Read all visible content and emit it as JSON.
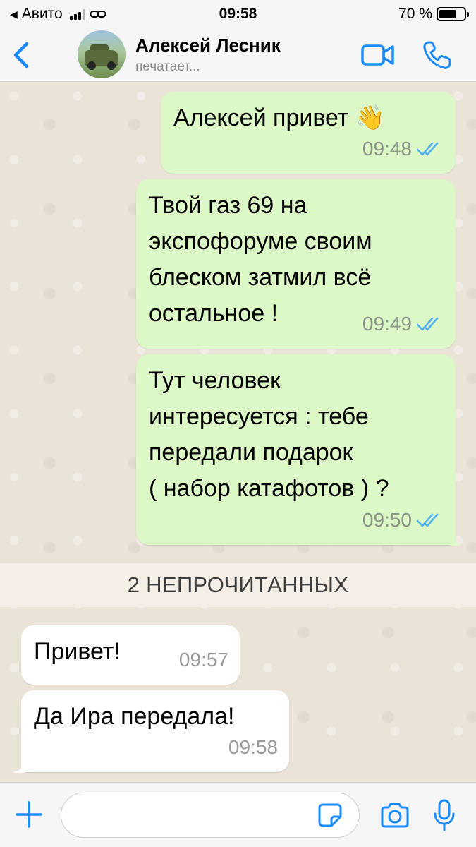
{
  "status_bar": {
    "back_app": "Авито",
    "time": "09:58",
    "battery_percent": "70 %",
    "battery_level": 0.7
  },
  "header": {
    "contact_name": "Алексей Лесник",
    "contact_status": "печатает...",
    "icons": [
      "chevron-left-icon",
      "video-camera-icon",
      "phone-icon"
    ]
  },
  "messages": [
    {
      "direction": "outgoing",
      "text": "Алексей привет 👋",
      "time": "09:48",
      "read": true
    },
    {
      "direction": "outgoing",
      "text": "Твой газ 69 на\nэкспофоруме своим\nблеском затмил всё\nостальное !",
      "time": "09:49",
      "read": true
    },
    {
      "direction": "outgoing",
      "text": "Тут человек\nинтересуется : тебе\nпередали подарок\n( набор катафотов ) ?",
      "time": "09:50",
      "read": true
    },
    {
      "direction": "incoming",
      "text": "Привет!",
      "time": "09:57"
    },
    {
      "direction": "incoming",
      "text": "Да Ира передала!",
      "time": "09:58"
    }
  ],
  "unread_divider": "2 НЕПРОЧИТАННЫХ",
  "input": {
    "value": "",
    "icons": [
      "plus-icon",
      "sticker-icon",
      "camera-icon",
      "microphone-icon"
    ]
  },
  "colors": {
    "accent": "#1a8cff",
    "outgoing_bubble": "#dcf8c6",
    "incoming_bubble": "#ffffff",
    "read_ticks": "#4fb0f0"
  }
}
